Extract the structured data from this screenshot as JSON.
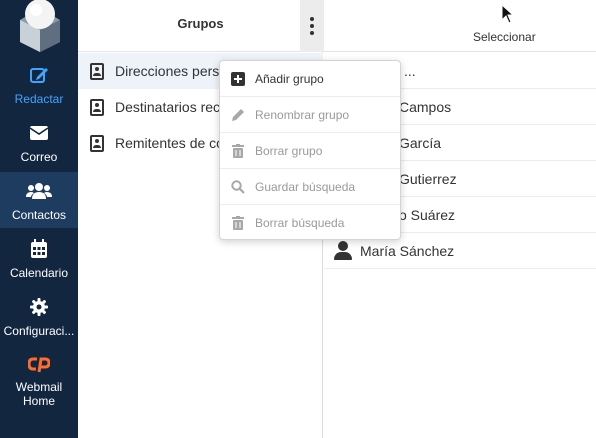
{
  "sidebar": {
    "items": [
      {
        "label": "Redactar",
        "icon": "compose-icon"
      },
      {
        "label": "Correo",
        "icon": "envelope-icon"
      },
      {
        "label": "Contactos",
        "icon": "users-icon"
      },
      {
        "label": "Calendario",
        "icon": "calendar-icon"
      },
      {
        "label": "Configuraci...",
        "icon": "gear-icon"
      },
      {
        "label": "Webmail Home",
        "icon": "cpanel-icon"
      }
    ],
    "active": "Contactos"
  },
  "groups": {
    "title": "Grupos",
    "items": [
      {
        "label": "Direcciones personales"
      },
      {
        "label": "Destinatarios recopilados"
      },
      {
        "label": "Remitentes de confianza"
      }
    ]
  },
  "contacts": {
    "select_label": "Seleccionar",
    "items": [
      {
        "name": "..."
      },
      {
        "name": "Campos"
      },
      {
        "name": "García"
      },
      {
        "name": "Gutierrez"
      },
      {
        "name": "o Suárez"
      },
      {
        "name": "María Sánchez"
      }
    ]
  },
  "menu": {
    "items": [
      {
        "label": "Añadir grupo",
        "enabled": true,
        "icon": "plus-square-icon"
      },
      {
        "label": "Renombrar grupo",
        "enabled": false,
        "icon": "pencil-icon"
      },
      {
        "label": "Borrar grupo",
        "enabled": false,
        "icon": "trash-icon"
      },
      {
        "label": "Guardar búsqueda",
        "enabled": false,
        "icon": "search-icon"
      },
      {
        "label": "Borrar búsqueda",
        "enabled": false,
        "icon": "trash-icon"
      }
    ]
  },
  "colors": {
    "sidebar_bg": "#122640",
    "sidebar_active": "#1e3b60",
    "accent": "#3fa6ff",
    "cpanel_orange": "#ff6c2c"
  }
}
